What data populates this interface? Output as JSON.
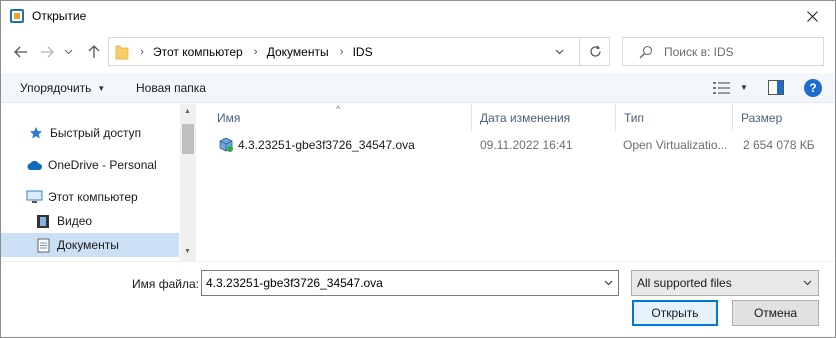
{
  "window": {
    "title": "Открытие"
  },
  "address": {
    "crumbs": [
      "Этот компьютер",
      "Документы",
      "IDS"
    ]
  },
  "search": {
    "placeholder": "Поиск в: IDS"
  },
  "toolbar": {
    "organize_label": "Упорядочить",
    "new_folder_label": "Новая папка"
  },
  "navpane": {
    "items": [
      {
        "label": "Быстрый доступ",
        "icon": "star-icon"
      },
      {
        "label": "OneDrive - Personal",
        "icon": "cloud-icon"
      },
      {
        "label": "Этот компьютер",
        "icon": "computer-icon"
      },
      {
        "label": "Видео",
        "icon": "video-icon"
      },
      {
        "label": "Документы",
        "icon": "document-icon",
        "selected": true
      }
    ]
  },
  "list": {
    "columns": [
      "Имя",
      "Дата изменения",
      "Тип",
      "Размер"
    ],
    "rows": [
      {
        "name": "4.3.23251-gbe3f3726_34547.ova",
        "date": "09.11.2022 16:41",
        "type": "Open Virtualizatio...",
        "size": "2 654 078 КБ",
        "icon": "ova-package-icon"
      }
    ]
  },
  "footer": {
    "filename_label": "Имя файла:",
    "filename_value": "4.3.23251-gbe3f3726_34547.ova",
    "filter_value": "All supported files",
    "open_label": "Открыть",
    "cancel_label": "Отмена"
  },
  "colors": {
    "accent": "#0078d7",
    "selection": "#cce0f5",
    "toolbar_bg": "#f3f6fb",
    "header_text": "#4c607a"
  }
}
